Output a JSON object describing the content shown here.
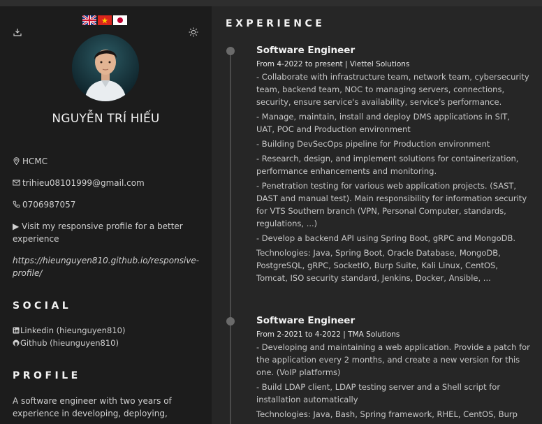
{
  "sidebar": {
    "name": "NGUYỄN TRÍ HIẾU",
    "location": "HCMC",
    "email": "trihieu08101999@gmail.com",
    "phone": "0706987057",
    "visit_text": "▶ Visit my responsive profile for a better experience",
    "profile_link": "https://hieunguyen810.github.io/responsive-profile/",
    "social_title": "SOCIAL",
    "social": [
      {
        "label": "Linkedin (hieunguyen810)",
        "icon": "linkedin-icon"
      },
      {
        "label": "Github (hieunguyen810)",
        "icon": "github-icon"
      }
    ],
    "profile_title": "PROFILE",
    "profile_text": "A software engineer with two years of experience in developing, deploying,",
    "icons": [
      "download-icon",
      "sun-icon",
      "uk-flag-icon",
      "vietnam-flag-icon",
      "japan-flag-icon"
    ]
  },
  "main": {
    "title": "EXPERIENCE",
    "jobs": [
      {
        "title": "Software Engineer",
        "meta": "From 4-2022 to present | Viettel Solutions",
        "lines": [
          "- Collaborate with infrastructure team, network team, cybersecurity team, backend team, NOC to managing servers, connections, security, ensure service's availability, service's performance.",
          "- Manage, maintain, install and deploy DMS applications in SIT, UAT, POC and Production environment",
          "- Building DevSecOps pipeline for Production environment",
          "- Research, design, and implement solutions for containerization, performance enhancements and monitoring.",
          "- Penetration testing for various web application projects. (SAST, DAST and manual test). Main responsibility for information security for VTS Southern branch (VPN, Personal Computer, standards, regulations, ...)",
          "- Develop a backend API using Spring Boot, gRPC and MongoDB.",
          "Technologies: Java, Spring Boot, Oracle Database, MongoDB, PostgreSQL, gRPC, SocketIO, Burp Suite, Kali Linux, CentOS, Tomcat, ISO security standard, Jenkins, Docker, Ansible, ..."
        ]
      },
      {
        "title": "Software Engineer",
        "meta": "From 2-2021 to 4-2022 | TMA Solutions",
        "lines": [
          "- Developing and maintaining a web application. Provide a patch for the application every 2 months, and create a new version for this one. (VoIP platforms)",
          "- Build LDAP client, LDAP testing server and a Shell script for installation automatically",
          "Technologies: Java, Bash, Spring framework, RHEL, CentOS, Burp"
        ]
      }
    ]
  },
  "colors": {
    "sidebar_bg": "#1c1c1c",
    "main_bg": "#262626",
    "timeline": "#4a4a4a"
  }
}
